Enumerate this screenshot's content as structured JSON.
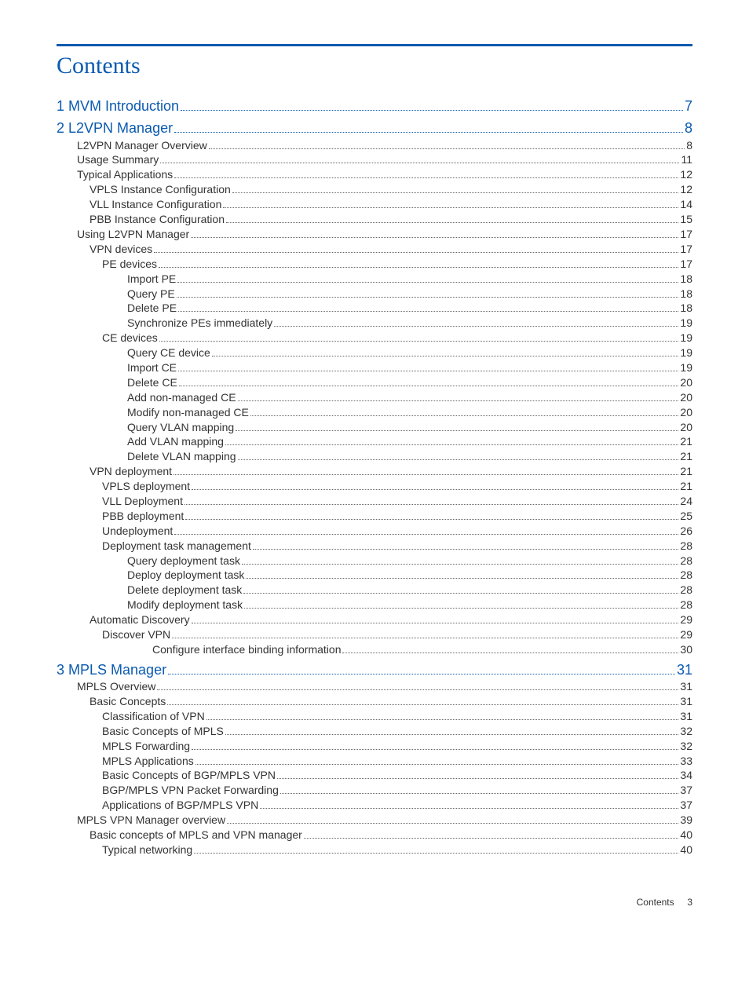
{
  "title": "Contents",
  "footer_label": "Contents",
  "footer_page": "3",
  "toc": [
    {
      "level": "sec",
      "label": "1 MVM Introduction",
      "page": "7"
    },
    {
      "level": "sec",
      "label": "2 L2VPN Manager",
      "page": "8"
    },
    {
      "level": "l1",
      "label": "L2VPN Manager Overview",
      "page": "8"
    },
    {
      "level": "l1",
      "label": "Usage Summary",
      "page": "11"
    },
    {
      "level": "l1",
      "label": "Typical Applications",
      "page": "12"
    },
    {
      "level": "l2",
      "label": "VPLS Instance Configuration",
      "page": "12"
    },
    {
      "level": "l2",
      "label": "VLL Instance Configuration",
      "page": "14"
    },
    {
      "level": "l2",
      "label": "PBB Instance Configuration",
      "page": "15"
    },
    {
      "level": "l1",
      "label": "Using L2VPN Manager",
      "page": "17"
    },
    {
      "level": "l2",
      "label": "VPN devices",
      "page": "17"
    },
    {
      "level": "l3",
      "label": "PE devices",
      "page": "17"
    },
    {
      "level": "l4",
      "label": "Import PE",
      "page": "18"
    },
    {
      "level": "l4",
      "label": "Query PE",
      "page": "18"
    },
    {
      "level": "l4",
      "label": "Delete PE",
      "page": "18"
    },
    {
      "level": "l4",
      "label": "Synchronize PEs immediately",
      "page": "19"
    },
    {
      "level": "l3",
      "label": "CE devices",
      "page": "19"
    },
    {
      "level": "l4",
      "label": "Query CE device",
      "page": "19"
    },
    {
      "level": "l4",
      "label": "Import CE",
      "page": "19"
    },
    {
      "level": "l4",
      "label": "Delete CE",
      "page": "20"
    },
    {
      "level": "l4",
      "label": "Add non-managed CE",
      "page": "20"
    },
    {
      "level": "l4",
      "label": "Modify non-managed CE",
      "page": "20"
    },
    {
      "level": "l4",
      "label": "Query VLAN mapping",
      "page": "20"
    },
    {
      "level": "l4",
      "label": "Add VLAN mapping",
      "page": "21"
    },
    {
      "level": "l4",
      "label": "Delete VLAN mapping",
      "page": "21"
    },
    {
      "level": "l2",
      "label": "VPN deployment",
      "page": "21"
    },
    {
      "level": "l3",
      "label": "VPLS deployment",
      "page": "21"
    },
    {
      "level": "l3",
      "label": "VLL Deployment",
      "page": "24"
    },
    {
      "level": "l3",
      "label": "PBB deployment",
      "page": "25"
    },
    {
      "level": "l3",
      "label": "Undeployment",
      "page": "26"
    },
    {
      "level": "l3",
      "label": "Deployment task management",
      "page": "28"
    },
    {
      "level": "l4",
      "label": "Query deployment task",
      "page": "28"
    },
    {
      "level": "l4",
      "label": "Deploy deployment task",
      "page": "28"
    },
    {
      "level": "l4",
      "label": "Delete deployment task",
      "page": "28"
    },
    {
      "level": "l4",
      "label": "Modify deployment task",
      "page": "28"
    },
    {
      "level": "l2",
      "label": "Automatic Discovery",
      "page": "29"
    },
    {
      "level": "l3",
      "label": "Discover VPN",
      "page": "29"
    },
    {
      "level": "l5",
      "label": "Configure interface binding information",
      "page": "30"
    },
    {
      "level": "sec",
      "label": "3 MPLS Manager",
      "page": "31"
    },
    {
      "level": "l1",
      "label": "MPLS Overview",
      "page": "31"
    },
    {
      "level": "l2",
      "label": "Basic Concepts",
      "page": "31"
    },
    {
      "level": "l3",
      "label": "Classification of VPN",
      "page": "31"
    },
    {
      "level": "l3",
      "label": "Basic Concepts of MPLS",
      "page": "32"
    },
    {
      "level": "l3",
      "label": "MPLS Forwarding",
      "page": "32"
    },
    {
      "level": "l3",
      "label": "MPLS Applications",
      "page": "33"
    },
    {
      "level": "l3",
      "label": "Basic Concepts of BGP/MPLS VPN",
      "page": "34"
    },
    {
      "level": "l3",
      "label": "BGP/MPLS VPN Packet Forwarding",
      "page": "37"
    },
    {
      "level": "l3",
      "label": "Applications of BGP/MPLS VPN",
      "page": "37"
    },
    {
      "level": "l1",
      "label": "MPLS VPN Manager overview",
      "page": "39"
    },
    {
      "level": "l2",
      "label": "Basic concepts of MPLS and VPN manager",
      "page": "40"
    },
    {
      "level": "l3",
      "label": "Typical networking",
      "page": "40"
    }
  ]
}
